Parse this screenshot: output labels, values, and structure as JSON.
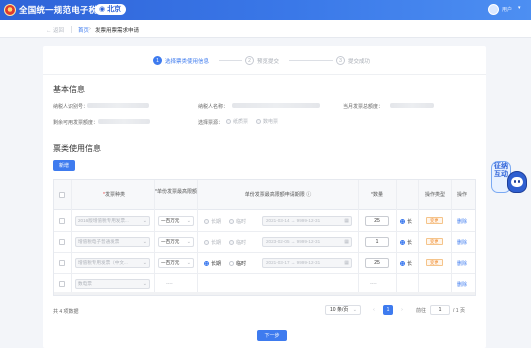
{
  "header": {
    "site_title": "全国统一规范电子税务局",
    "region": "北京",
    "user_name": "用户",
    "caret": "▾"
  },
  "breadcrumb": {
    "back": "← 返回",
    "home": "首页",
    "arrow": "›",
    "current": "发票用票需求申请"
  },
  "steps": [
    {
      "num": "1",
      "label": "选择票类使用信息"
    },
    {
      "num": "2",
      "label": "预览提交"
    },
    {
      "num": "3",
      "label": "提交成功"
    }
  ],
  "basic_info": {
    "title": "基本信息",
    "taxpayer_id_label": "纳税人识别号：",
    "taxpayer_name_label": "纳税人名称：",
    "current_quota_label": "当月发票总额度：",
    "remaining_quota_label": "剩余可用发票额度：",
    "ticket_type_label": "选择票源：",
    "ticket_options": [
      "纸质票",
      "数电票"
    ]
  },
  "usage_info": {
    "title": "票类使用信息",
    "add_button": "新增",
    "columns": {
      "type": "*发票种类",
      "limit": "*单份发票最高限额",
      "period": "单份发票最高限额申请期限",
      "period_icon": "ⓘ",
      "count": "*数量",
      "op_type": "操作类型",
      "action": "操作"
    },
    "rows": [
      {
        "type": "2016版增值税专用发票...",
        "limit": "一百万元",
        "period_long": "长期",
        "period_temp": "临时",
        "date_from": "2021-03-14",
        "date_to": "9999-12-31",
        "count": "25",
        "op_tag": "变更",
        "action": "删除",
        "selected": "long"
      },
      {
        "type": "增值税电子普通发票",
        "limit": "一百万元",
        "period_long": "长期",
        "period_temp": "临时",
        "date_from": "2023-02-05",
        "date_to": "9999-12-31",
        "count": "1",
        "op_tag": "变更",
        "action": "删除",
        "selected": "long"
      },
      {
        "type": "增值税专用发票（中文...",
        "limit": "一百万元",
        "period_long": "长期",
        "period_temp": "临时",
        "date_from": "2021-03-17",
        "date_to": "9999-12-31",
        "count": "25",
        "op_tag": "变更",
        "action": "删除",
        "selected": "long"
      },
      {
        "type": "数电票",
        "limit": "----",
        "count": "----",
        "action": "删除"
      }
    ],
    "long_short": "长"
  },
  "pagination": {
    "total": "共 4 项数据",
    "page_size": "10 条/页",
    "prev": "‹",
    "prev_more": "«",
    "current_page": "1",
    "next": "›",
    "next_more": "»",
    "goto_prefix": "前往",
    "goto_value": "1",
    "goto_suffix": "/ 1 页"
  },
  "next_button": "下一步",
  "assistant": {
    "text": "征纳互动"
  }
}
